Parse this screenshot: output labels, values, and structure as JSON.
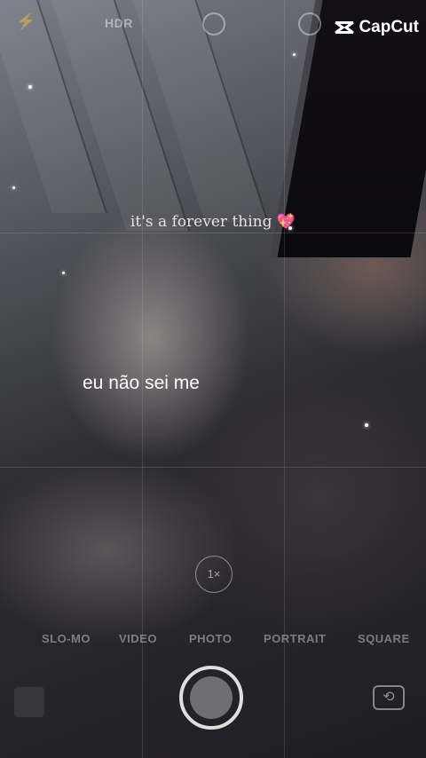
{
  "camera": {
    "top_bar": {
      "hdr_label": "HDR",
      "icons": [
        "flash-icon",
        "live-photo-icon",
        "timer-icon"
      ]
    },
    "zoom_label": "1×",
    "modes": [
      "SLO-MO",
      "VIDEO",
      "PHOTO",
      "PORTRAIT",
      "SQUARE"
    ],
    "selected_mode": "PHOTO"
  },
  "watermark": {
    "brand": "CapCut"
  },
  "captions": {
    "top": "it's a forever thing",
    "top_emoji": "💖",
    "main": "eu não sei me"
  },
  "colors": {
    "overlay_text": "#ffffff",
    "heart": "#ff3b8d",
    "background": "#1b1a20"
  }
}
